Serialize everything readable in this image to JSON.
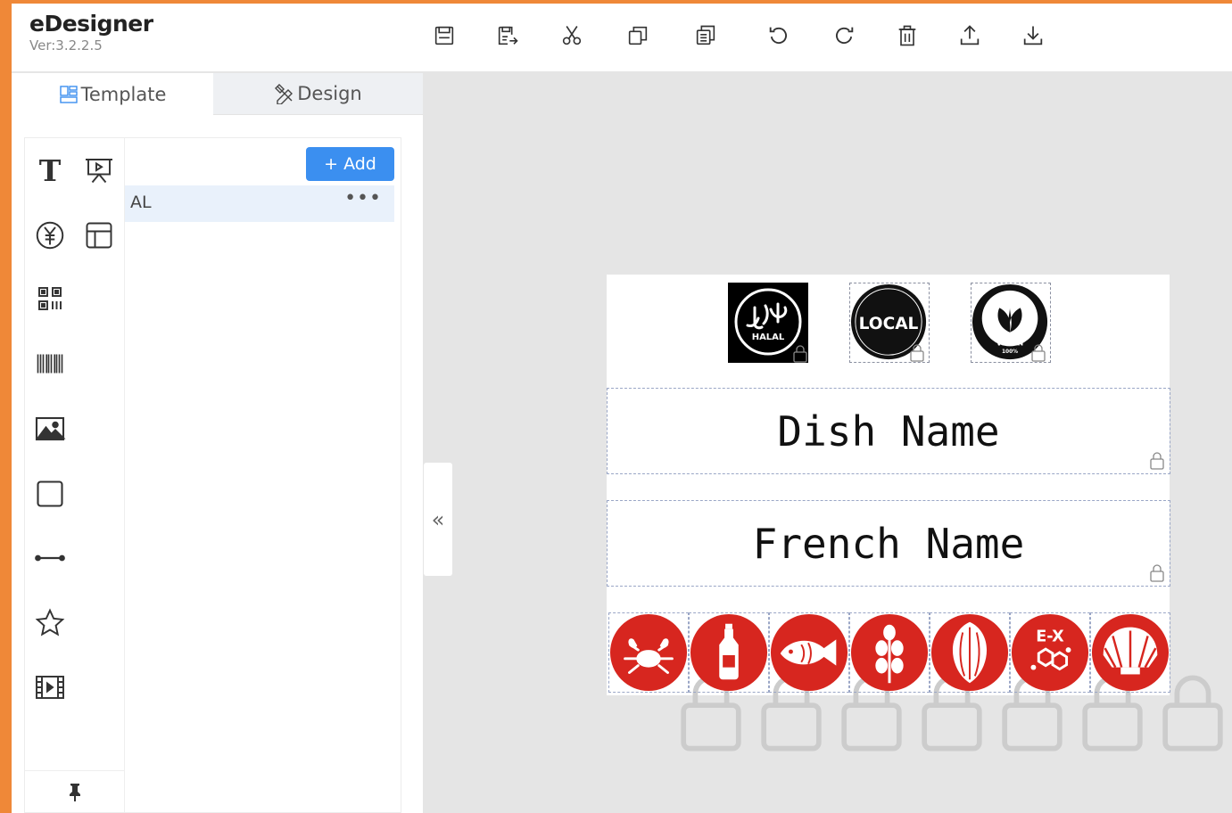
{
  "app": {
    "title": "eDesigner",
    "version": "Ver:3.2.2.5"
  },
  "toolbar": {
    "items": [
      "save-icon",
      "save-as-icon",
      "cut-icon",
      "copy-icon",
      "paste-icon",
      "undo-icon",
      "redo-icon",
      "delete-icon",
      "upload-icon",
      "download-icon"
    ]
  },
  "tabs": {
    "template": "Template",
    "design": "Design"
  },
  "panel": {
    "add_label": "+ Add",
    "item_label": " AL",
    "more_label": "•••",
    "collapse_label": "«"
  },
  "tools": [
    "text-icon",
    "presentation-icon",
    "currency-icon",
    "layout-icon",
    "qr-code-icon",
    "barcode-icon",
    "image-icon",
    "rectangle-icon",
    "line-icon",
    "star-icon",
    "video-icon",
    "pin-icon"
  ],
  "label": {
    "dish_name": "Dish Name",
    "french_name": "French Name",
    "badges": {
      "halal_text": "HALAL",
      "local_text": "LOCAL",
      "vegan_text": "VEGAN",
      "vegan_sub": "100%"
    },
    "allergens": [
      "crab-icon",
      "bottle-icon",
      "fish-icon",
      "sesame-icon",
      "nut-icon",
      "additive-icon",
      "shell-icon"
    ],
    "additive_text": "E-X"
  },
  "colors": {
    "brand_orange": "#ef8838",
    "primary_blue": "#3b8ff0",
    "allergen_red": "#d7261f"
  }
}
